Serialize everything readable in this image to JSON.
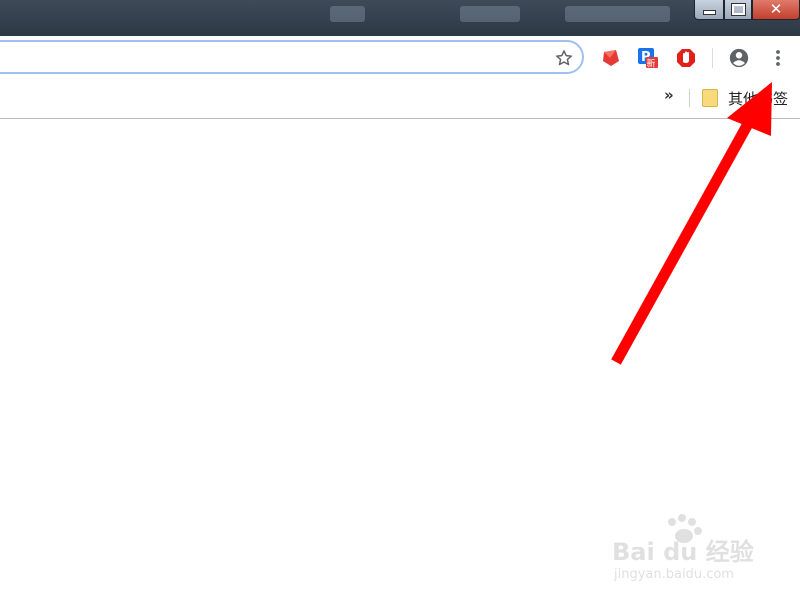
{
  "window": {
    "controls": {
      "minimize": "minimize",
      "maximize": "maximize",
      "close": "close"
    }
  },
  "toolbar": {
    "bookmark_star_icon": "star-icon",
    "extensions": [
      {
        "name": "red-extension-icon",
        "color": "#e53935"
      },
      {
        "name": "p-extension-icon",
        "badge": "新",
        "color": "#1a73e8"
      },
      {
        "name": "stop-extension-icon",
        "color": "#e0201b"
      }
    ],
    "account_icon": "account-circle-icon",
    "menu_icon": "three-dot-menu-icon"
  },
  "bookmarks_bar": {
    "overflow_label": "»",
    "items": [
      {
        "label": "其他书签",
        "icon": "folder-icon"
      }
    ]
  },
  "annotation": {
    "color": "#ff0000"
  },
  "watermark": {
    "brand": "Bai du 经验",
    "url": "jingyan.baidu.com"
  }
}
